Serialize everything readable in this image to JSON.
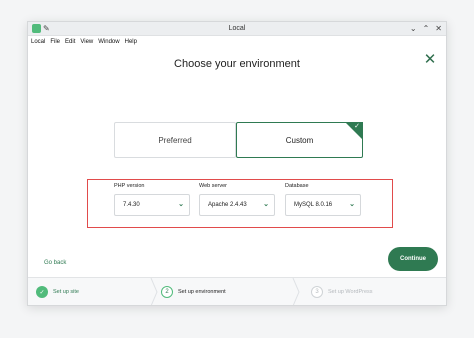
{
  "window": {
    "title": "Local",
    "menu": [
      "Local",
      "File",
      "Edit",
      "View",
      "Window",
      "Help"
    ]
  },
  "heading": "Choose your environment",
  "environment_options": {
    "preferred": "Preferred",
    "custom": "Custom",
    "selected": "Custom"
  },
  "fields": {
    "php": {
      "label": "PHP version",
      "value": "7.4.30"
    },
    "web_server": {
      "label": "Web server",
      "value": "Apache 2.4.43"
    },
    "database": {
      "label": "Database",
      "value": "MySQL 8.0.16"
    }
  },
  "actions": {
    "go_back": "Go back",
    "continue": "Continue"
  },
  "steps": [
    {
      "number": "1",
      "label": "Set up site",
      "state": "done"
    },
    {
      "number": "2",
      "label": "Set up environment",
      "state": "current"
    },
    {
      "number": "3",
      "label": "Set up WordPress",
      "state": "todo"
    }
  ],
  "colors": {
    "accent": "#2f7a52",
    "accent_light": "#51bb7b",
    "highlight_border": "#e14b4b"
  }
}
